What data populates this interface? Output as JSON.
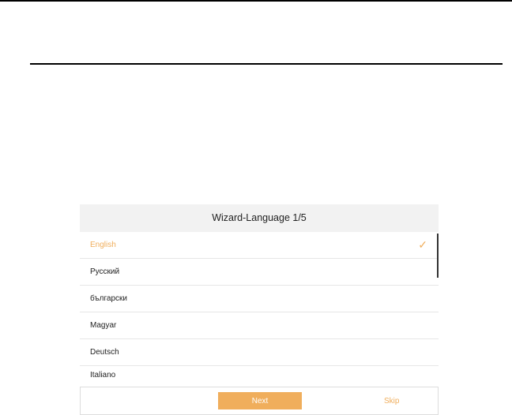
{
  "dialog": {
    "title": "Wizard-Language 1/5",
    "languages": [
      {
        "label": "English",
        "selected": true
      },
      {
        "label": "Русский",
        "selected": false
      },
      {
        "label": "български",
        "selected": false
      },
      {
        "label": "Magyar",
        "selected": false
      },
      {
        "label": "Deutsch",
        "selected": false
      },
      {
        "label": "Italiano",
        "selected": false
      }
    ],
    "check_icon": "✓",
    "next_label": "Next",
    "skip_label": "Skip"
  },
  "colors": {
    "accent": "#f0ae5c",
    "header_bg": "#f2f2f2"
  }
}
